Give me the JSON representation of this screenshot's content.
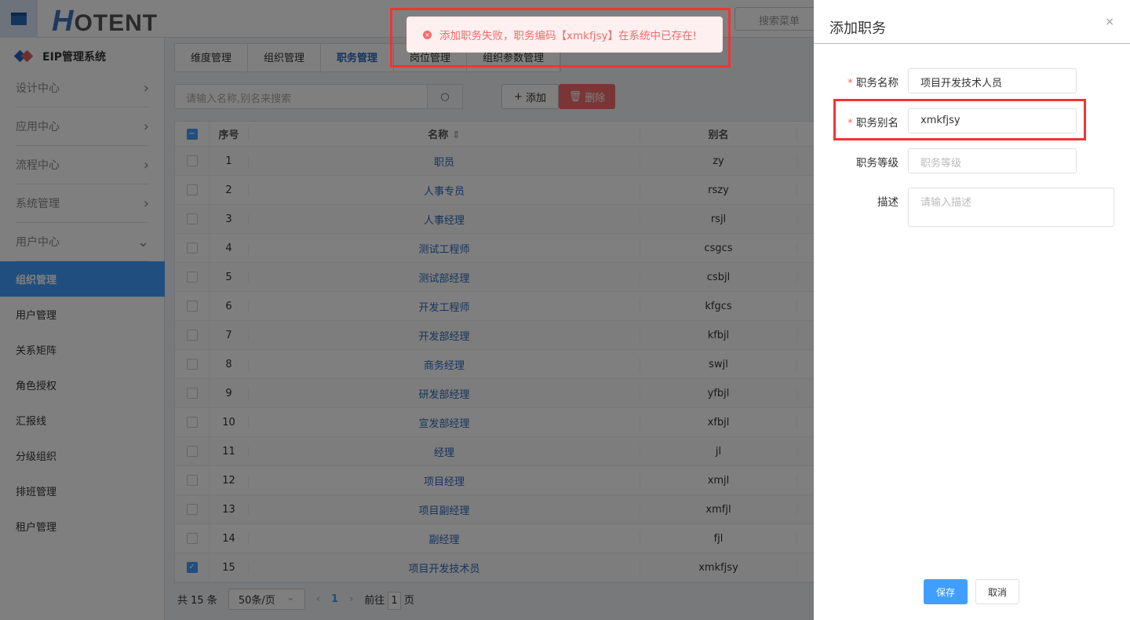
{
  "header": {
    "logo": "HOTENT",
    "menu_search_placeholder": "搜索菜单"
  },
  "sidebar": {
    "brand": "EIP管理系统",
    "groups": [
      "设计中心",
      "应用中心",
      "流程中心",
      "系统管理",
      "用户中心"
    ],
    "items": [
      "组织管理",
      "用户管理",
      "关系矩阵",
      "角色授权",
      "汇报线",
      "分级组织",
      "排班管理",
      "租户管理"
    ]
  },
  "tabs": [
    "维度管理",
    "组织管理",
    "职务管理",
    "岗位管理",
    "组织参数管理"
  ],
  "toolbar": {
    "search_placeholder": "请输入名称,别名来搜索",
    "add": "添加",
    "delete": "删除"
  },
  "table": {
    "headers": [
      "序号",
      "名称",
      "别名"
    ],
    "rows": [
      [
        "1",
        "职员",
        "zy"
      ],
      [
        "2",
        "人事专员",
        "rszy"
      ],
      [
        "3",
        "人事经理",
        "rsjl"
      ],
      [
        "4",
        "测试工程师",
        "csgcs"
      ],
      [
        "5",
        "测试部经理",
        "csbjl"
      ],
      [
        "6",
        "开发工程师",
        "kfgcs"
      ],
      [
        "7",
        "开发部经理",
        "kfbjl"
      ],
      [
        "8",
        "商务经理",
        "swjl"
      ],
      [
        "9",
        "研发部经理",
        "yfbjl"
      ],
      [
        "10",
        "宣发部经理",
        "xfbjl"
      ],
      [
        "11",
        "经理",
        "jl"
      ],
      [
        "12",
        "项目经理",
        "xmjl"
      ],
      [
        "13",
        "项目副经理",
        "xmfjl"
      ],
      [
        "14",
        "副经理",
        "fjl"
      ],
      [
        "15",
        "项目开发技术员",
        "xmkfjsy"
      ]
    ],
    "checked_row": "15"
  },
  "pager": {
    "total": "共 15 条",
    "page_size": "50条/页",
    "current": "1",
    "goto_label": "前往",
    "goto_value": "1",
    "page_suffix": "页"
  },
  "toast": {
    "message": "添加职务失败，职务编码【xmkfjsy】在系统中已存在!"
  },
  "drawer": {
    "title": "添加职务",
    "close": "×",
    "fields": [
      {
        "label": "职务名称",
        "required": true,
        "value": "项目开发技术人员"
      },
      {
        "label": "职务别名",
        "required": true,
        "value": "xmkfjsy"
      },
      {
        "label": "职务等级",
        "required": false,
        "placeholder": "职务等级"
      },
      {
        "label": "描述",
        "required": false,
        "placeholder": "请输入描述"
      }
    ],
    "save": "保存",
    "cancel": "取消"
  }
}
